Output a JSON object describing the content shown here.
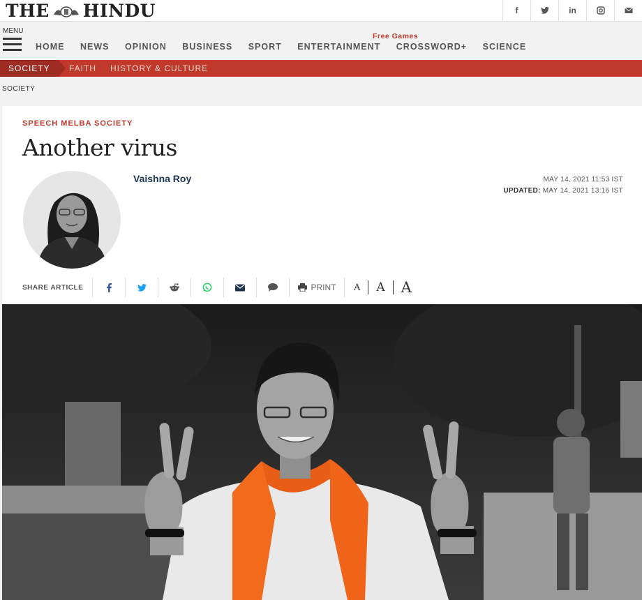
{
  "masthead": {
    "logo_left": "THE",
    "logo_right": "HINDU",
    "social": [
      {
        "icon": "facebook-icon",
        "glyph": "f"
      },
      {
        "icon": "twitter-icon",
        "glyph": "t"
      },
      {
        "icon": "linkedin-icon",
        "glyph": "in"
      },
      {
        "icon": "instagram-icon",
        "glyph": ""
      },
      {
        "icon": "mail-icon",
        "glyph": ""
      }
    ]
  },
  "nav": {
    "menu_label": "MENU",
    "items": [
      "HOME",
      "NEWS",
      "OPINION",
      "BUSINESS",
      "SPORT",
      "ENTERTAINMENT",
      "CROSSWORD+",
      "SCIENCE"
    ],
    "free_games": "Free Games"
  },
  "section_bar": {
    "active": "SOCIETY",
    "items": [
      "FAITH",
      "HISTORY & CULTURE"
    ]
  },
  "breadcrumb": "SOCIETY",
  "article": {
    "kicker": "SPEECH MELBA SOCIETY",
    "headline": "Another virus",
    "author": "Vaishna Roy",
    "published": "MAY 14, 2021 11:53 IST",
    "updated_label": "UPDATED:",
    "updated": "MAY 14, 2021 13:16 IST"
  },
  "share": {
    "label": "SHARE ARTICLE",
    "print_label": "PRINT",
    "font_size_glyph": "A"
  },
  "colors": {
    "brand_red": "#c0392b",
    "author_blue": "#1e3553",
    "facebook": "#3b5998",
    "twitter": "#1da1f2",
    "whatsapp": "#25d366",
    "saffron": "#f26b1d"
  }
}
